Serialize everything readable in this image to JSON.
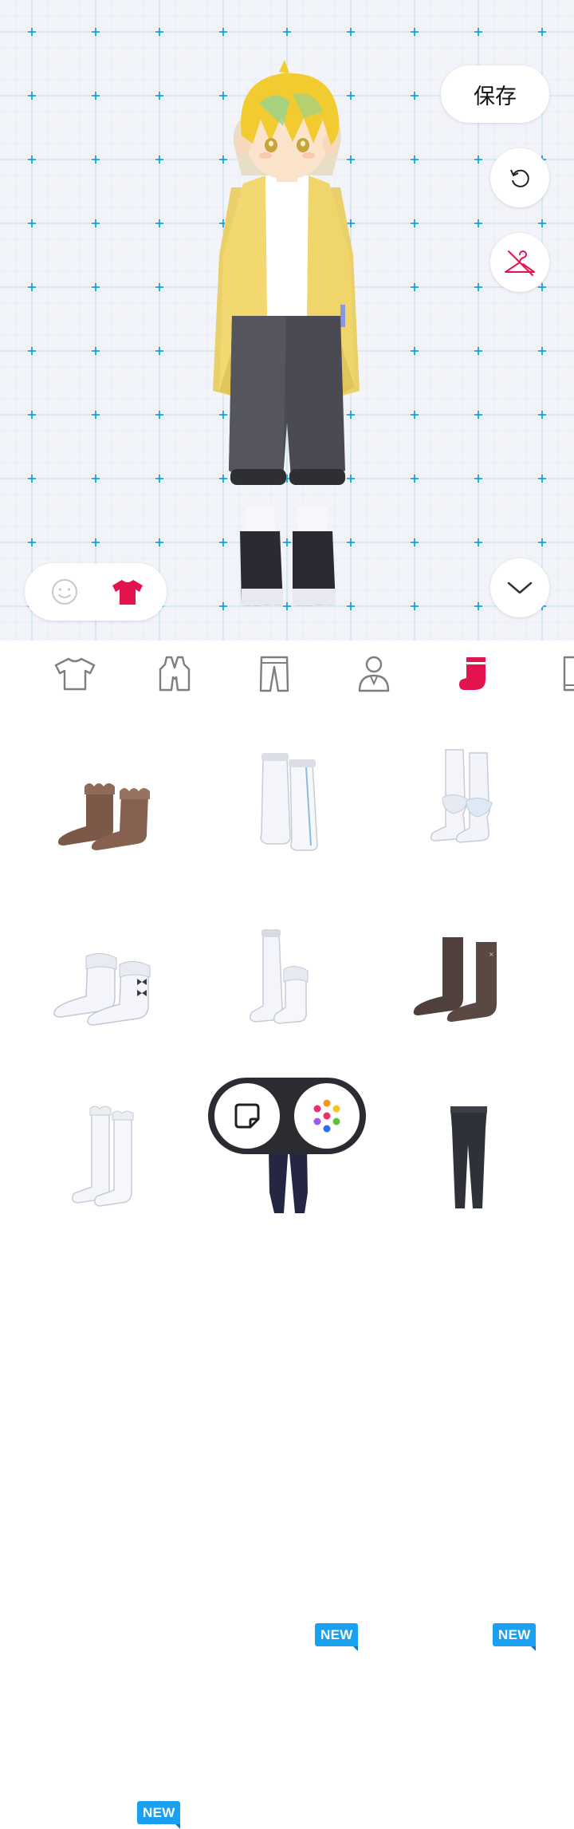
{
  "header": {
    "save_label": "保存"
  },
  "colors": {
    "accent": "#e3134e",
    "stage_bg": "#f3f4f9",
    "grid": "#1a9fd6",
    "new_badge": "#1aa0f0"
  },
  "tools": [
    {
      "icon": "rotate-reset-icon"
    },
    {
      "icon": "hide-clothes-icon"
    },
    {
      "icon": "chevron-down-icon"
    }
  ],
  "mode_toggle": [
    {
      "icon": "face-icon",
      "selected": false
    },
    {
      "icon": "shirt-icon",
      "selected": true
    }
  ],
  "category_tabs": [
    {
      "icon": "tshirt-icon",
      "selected": false
    },
    {
      "icon": "vest-icon",
      "selected": false
    },
    {
      "icon": "pants-icon",
      "selected": false
    },
    {
      "icon": "suit-person-icon",
      "selected": false
    },
    {
      "icon": "sock-icon",
      "selected": true
    },
    {
      "icon": "boot-icon",
      "selected": false
    }
  ],
  "items": [
    {
      "name": "brown-ruffle-socks",
      "new": false
    },
    {
      "name": "white-knee-socks",
      "new": false
    },
    {
      "name": "white-slouch-leg-warmers",
      "new": false
    },
    {
      "name": "white-bow-socks",
      "new": false
    },
    {
      "name": "white-mismatched-socks",
      "new": true,
      "badge": "NEW"
    },
    {
      "name": "dark-brown-socks",
      "new": true,
      "badge": "NEW"
    },
    {
      "name": "white-ruffle-knee-socks",
      "new": true,
      "badge": "NEW"
    },
    {
      "name": "navy-tights",
      "new": false
    },
    {
      "name": "black-leggings",
      "new": false
    }
  ],
  "bottom_actions": [
    {
      "icon": "sticker-icon"
    },
    {
      "icon": "palette-icon"
    }
  ]
}
